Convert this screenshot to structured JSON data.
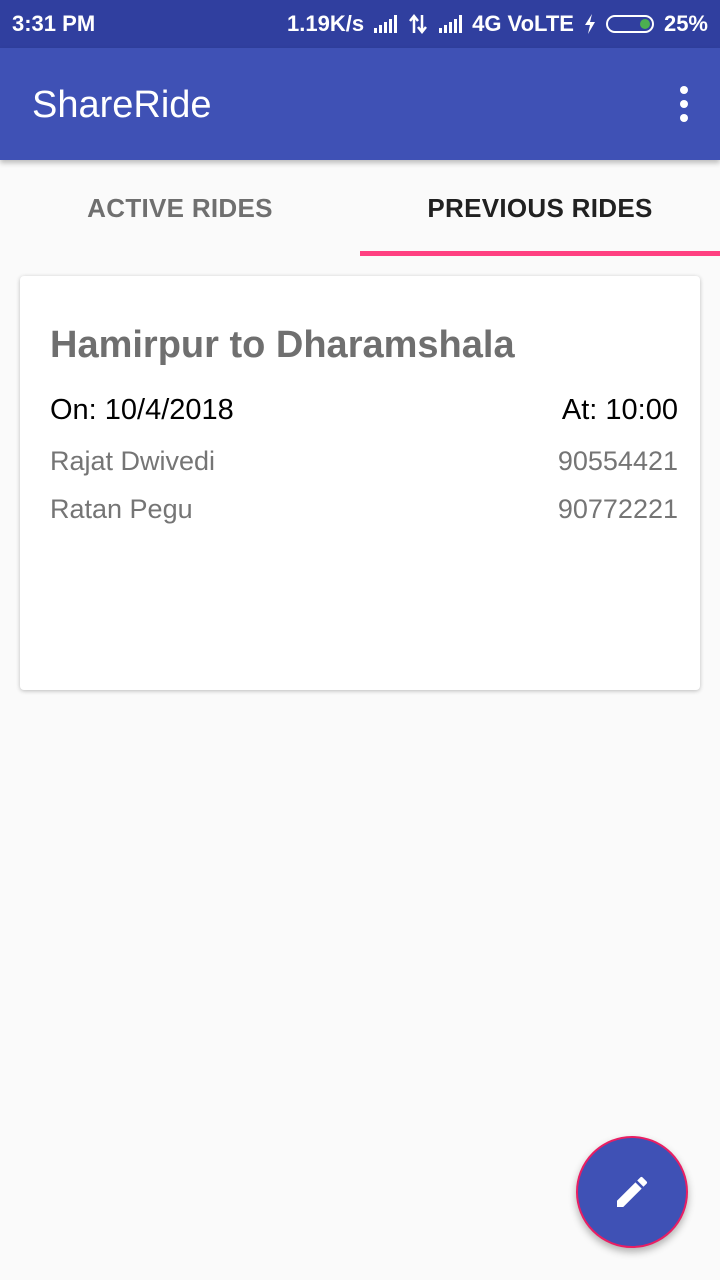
{
  "status_bar": {
    "time": "3:31 PM",
    "net_speed": "1.19K/s",
    "network": "4G VoLTE",
    "battery": "25%",
    "battery_color": "#4caf50"
  },
  "app_bar": {
    "title": "ShareRide",
    "color": "#3f51b5",
    "overflow_icon": "more-vert-icon"
  },
  "tabs": [
    {
      "label": "ACTIVE RIDES",
      "selected": false
    },
    {
      "label": "PREVIOUS RIDES",
      "selected": true
    }
  ],
  "tab_indicator_color": "#ff4081",
  "rides": [
    {
      "route": "Hamirpur to Dharamshala",
      "date": "On: 10/4/2018",
      "time": "At: 10:00",
      "passengers": [
        {
          "name": "Rajat Dwivedi",
          "phone": "90554421"
        },
        {
          "name": "Ratan Pegu",
          "phone": "90772221"
        }
      ]
    }
  ],
  "fab": {
    "icon": "edit-pencil-icon",
    "color": "#3f51b5"
  }
}
